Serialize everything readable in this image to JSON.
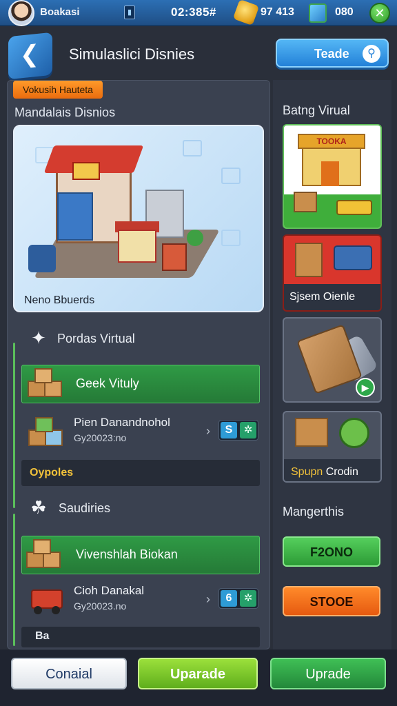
{
  "status_bar": {
    "player_name": "Boakasi",
    "timer": "02:385#",
    "coins": "97 413",
    "gems": "080",
    "settings_glyph": "✕"
  },
  "header": {
    "title": "Simulaslici Disnies",
    "trade_label": "Teade"
  },
  "left": {
    "tag": "Vokusih Hauteta",
    "section_title": "Mandalais Disnios",
    "hero_caption": "Neno Bbuerds",
    "group1": {
      "title": "Pordas Virtual",
      "green_row": "Geek Vituly",
      "item": {
        "title": "Pien Danandnohol",
        "subtitle": "Gy20023:no",
        "count": "S"
      },
      "strip": "Oypoles"
    },
    "group2": {
      "title": "Saudiries",
      "green_row": "Vivenshlah Biokan",
      "item": {
        "title": "Cioh Danakal",
        "subtitle": "Gy20023.no",
        "count": "6"
      },
      "strip_partial": "Ba"
    }
  },
  "right": {
    "title": "Batng Virual",
    "store_sign": "TOOKA",
    "dist_label": "Sjsem Oienle",
    "supply_label_a": "Spupn",
    "supply_label_b": "Crodin",
    "manage_title": "Mangerthis",
    "btn_green": "F2ONO",
    "btn_orange": "STOOE"
  },
  "bottom": {
    "cancel": "Conaial",
    "upgrade1": "Uparade",
    "upgrade2": "Uprade"
  },
  "icons": {
    "back": "back-arrow-icon",
    "search": "search-icon",
    "star": "star-icon",
    "leaf": "leaf-icon",
    "play": "play-icon"
  }
}
